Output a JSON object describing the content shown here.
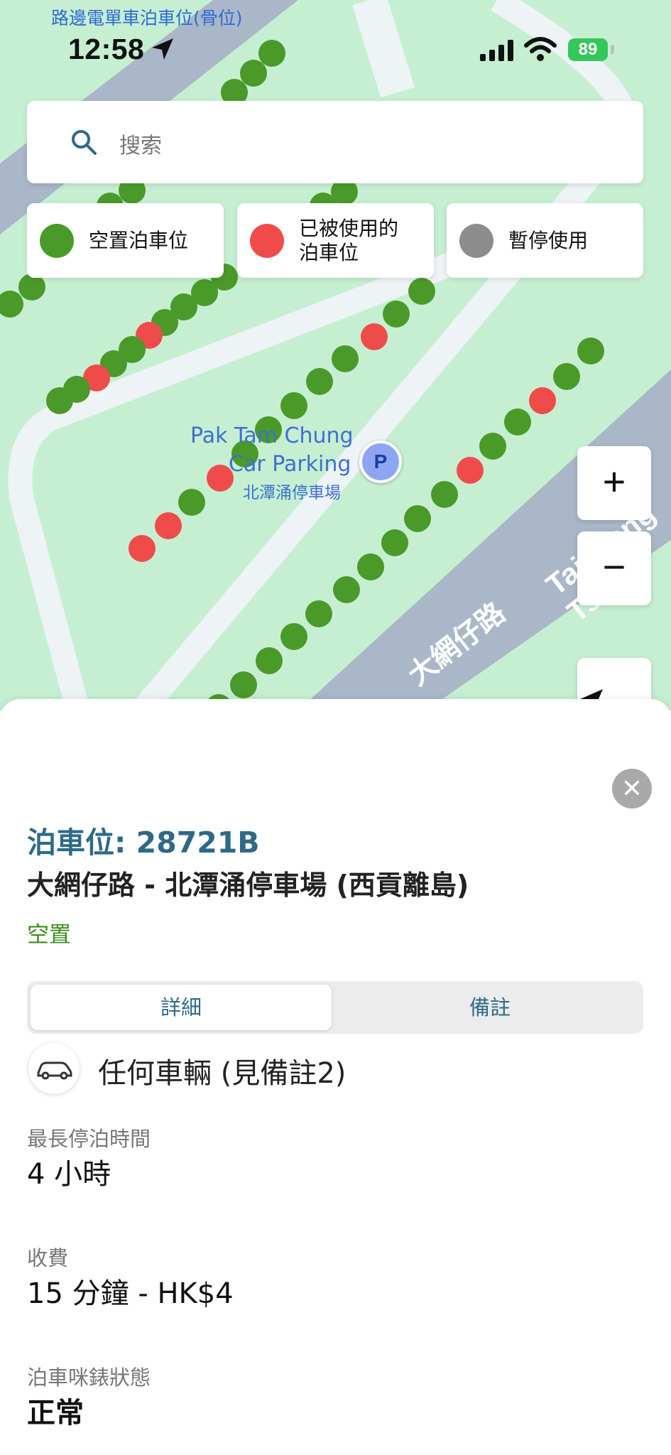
{
  "status_bar": {
    "time": "12:58",
    "battery": "89"
  },
  "map": {
    "top_label": "路邊電單車泊車位(骨位)",
    "place_label_en_1": "Pak Tam Chung",
    "place_label_en_2": "Car Parking",
    "place_label_zh": "北潭涌停車場",
    "parking_pin": "P",
    "road_label_zh": "大網仔路",
    "road_label_en": "Tai Mong Tsai"
  },
  "search": {
    "placeholder": "搜索"
  },
  "legend": [
    {
      "label": "空置泊車位",
      "color": "#4a9a2a"
    },
    {
      "label": "已被使用的泊車位",
      "color": "#f04b4b"
    },
    {
      "label": "暫停使用",
      "color": "#8c8c8c"
    }
  ],
  "controls": {
    "zoom_in": "+",
    "zoom_out": "−"
  },
  "detail": {
    "spot_title": "泊車位: 28721B",
    "spot_name": "大網仔路 - 北潭涌停車場 (西貢離島)",
    "status": "空置",
    "tabs": [
      "詳細",
      "備註"
    ],
    "vehicle": "任何車輛 (見備註2)",
    "fields": [
      {
        "label": "最長停泊時間",
        "value": "4 小時"
      },
      {
        "label": "收費",
        "value": "15 分鐘 - HK$4"
      },
      {
        "label": "泊車咪錶狀態",
        "value": "正常"
      }
    ]
  }
}
